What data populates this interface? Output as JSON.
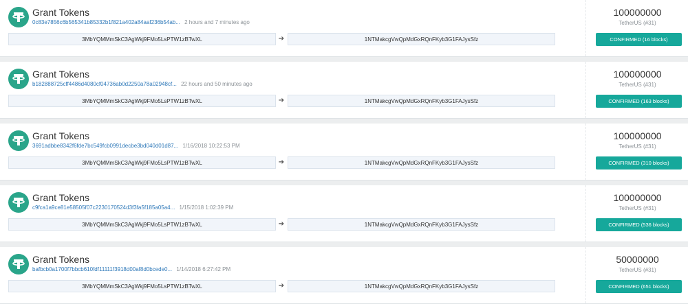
{
  "transactions": [
    {
      "title": "Grant Tokens",
      "hash": "0c83e7856c6b565341b85332b1f821a402a84aaf236b54ab...",
      "time": "2 hours and 7 minutes ago",
      "from_address": "3MbYQMMmSkC3AgWkj9FMo5LsPTW1zBTwXL",
      "to_address": "1NTMakcgVwQpMdGxRQnFKyb3G1FAJysSfz",
      "amount": "100000000",
      "currency": "TetherUS (#31)",
      "status": "CONFIRMED (16 blocks)"
    },
    {
      "title": "Grant Tokens",
      "hash": "b182888725cff4486d4080cf04736ab0d2250a78a02948cf...",
      "time": "22 hours and 50 minutes ago",
      "from_address": "3MbYQMMmSkC3AgWkj9FMo5LsPTW1zBTwXL",
      "to_address": "1NTMakcgVwQpMdGxRQnFKyb3G1FAJysSfz",
      "amount": "100000000",
      "currency": "TetherUS (#31)",
      "status": "CONFIRMED (163 blocks)"
    },
    {
      "title": "Grant Tokens",
      "hash": "3691adbbe8342f6fde7bc549fcb0991decbe3bd040d01d87...",
      "time": "1/16/2018 10:22:53 PM",
      "from_address": "3MbYQMMmSkC3AgWkj9FMo5LsPTW1zBTwXL",
      "to_address": "1NTMakcgVwQpMdGxRQnFKyb3G1FAJysSfz",
      "amount": "100000000",
      "currency": "TetherUS (#31)",
      "status": "CONFIRMED (310 blocks)"
    },
    {
      "title": "Grant Tokens",
      "hash": "c9fca1a9ce81e58505f07c2230170524d3f3fa5f185a05a4...",
      "time": "1/15/2018 1:02:39 PM",
      "from_address": "3MbYQMMmSkC3AgWkj9FMo5LsPTW1zBTwXL",
      "to_address": "1NTMakcgVwQpMdGxRQnFKyb3G1FAJysSfz",
      "amount": "100000000",
      "currency": "TetherUS (#31)",
      "status": "CONFIRMED (536 blocks)"
    },
    {
      "title": "Grant Tokens",
      "hash": "bafbcb0a1700f7bbcb610fdf11111f3918d00af8d0bcede0...",
      "time": "1/14/2018 6:27:42 PM",
      "from_address": "3MbYQMMmSkC3AgWkj9FMo5LsPTW1zBTwXL",
      "to_address": "1NTMakcgVwQpMdGxRQnFKyb3G1FAJysSfz",
      "amount": "50000000",
      "currency": "TetherUS (#31)",
      "status": "CONFIRMED (651 blocks)"
    }
  ],
  "arrow_icon": "arrow-right-icon",
  "token_icon": "tether-logo-icon",
  "colors": {
    "logo": "#2aa58a",
    "hash_link": "#2f79b9",
    "status_badge": "#16a89b",
    "address_bg": "#f1f5fa",
    "page_bg": "#eceeef"
  }
}
